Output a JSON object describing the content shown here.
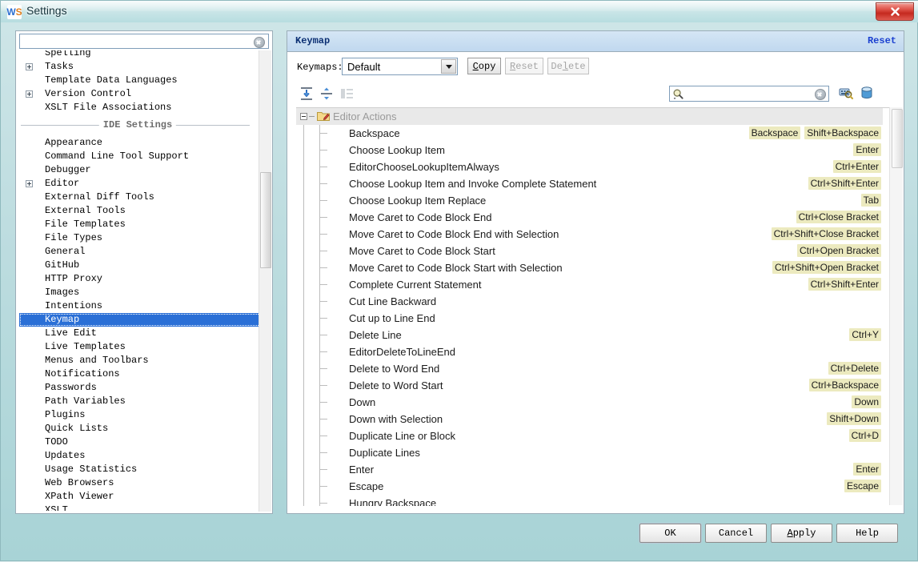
{
  "window": {
    "title": "Settings",
    "app_icon": "webstorm-icon",
    "close_label": "close-icon"
  },
  "sidebar": {
    "search": {
      "value": "",
      "placeholder": ""
    },
    "clear_icon": "clear-icon",
    "sections": [
      {
        "type": "items",
        "items": [
          {
            "label": "Spelling",
            "expandable": false,
            "selected": false
          },
          {
            "label": "Tasks",
            "expandable": true,
            "selected": false
          },
          {
            "label": "Template Data Languages",
            "expandable": false,
            "selected": false
          },
          {
            "label": "Version Control",
            "expandable": true,
            "selected": false
          },
          {
            "label": "XSLT File Associations",
            "expandable": false,
            "selected": false
          }
        ]
      },
      {
        "type": "separator",
        "label": "IDE Settings"
      },
      {
        "type": "items",
        "items": [
          {
            "label": "Appearance",
            "expandable": false,
            "selected": false
          },
          {
            "label": "Command Line Tool Support",
            "expandable": false,
            "selected": false
          },
          {
            "label": "Debugger",
            "expandable": false,
            "selected": false
          },
          {
            "label": "Editor",
            "expandable": true,
            "selected": false
          },
          {
            "label": "External Diff Tools",
            "expandable": false,
            "selected": false
          },
          {
            "label": "External Tools",
            "expandable": false,
            "selected": false
          },
          {
            "label": "File Templates",
            "expandable": false,
            "selected": false
          },
          {
            "label": "File Types",
            "expandable": false,
            "selected": false
          },
          {
            "label": "General",
            "expandable": false,
            "selected": false
          },
          {
            "label": "GitHub",
            "expandable": false,
            "selected": false
          },
          {
            "label": "HTTP Proxy",
            "expandable": false,
            "selected": false
          },
          {
            "label": "Images",
            "expandable": false,
            "selected": false
          },
          {
            "label": "Intentions",
            "expandable": false,
            "selected": false
          },
          {
            "label": "Keymap",
            "expandable": false,
            "selected": true
          },
          {
            "label": "Live Edit",
            "expandable": false,
            "selected": false
          },
          {
            "label": "Live Templates",
            "expandable": false,
            "selected": false
          },
          {
            "label": "Menus and Toolbars",
            "expandable": false,
            "selected": false
          },
          {
            "label": "Notifications",
            "expandable": false,
            "selected": false
          },
          {
            "label": "Passwords",
            "expandable": false,
            "selected": false
          },
          {
            "label": "Path Variables",
            "expandable": false,
            "selected": false
          },
          {
            "label": "Plugins",
            "expandable": false,
            "selected": false
          },
          {
            "label": "Quick Lists",
            "expandable": false,
            "selected": false
          },
          {
            "label": "TODO",
            "expandable": false,
            "selected": false
          },
          {
            "label": "Updates",
            "expandable": false,
            "selected": false
          },
          {
            "label": "Usage Statistics",
            "expandable": false,
            "selected": false
          },
          {
            "label": "Web Browsers",
            "expandable": false,
            "selected": false
          },
          {
            "label": "XPath Viewer",
            "expandable": false,
            "selected": false
          },
          {
            "label": "XSLT",
            "expandable": false,
            "selected": false
          }
        ]
      }
    ]
  },
  "panel": {
    "title": "Keymap",
    "reset_link": "Reset",
    "keymaps_label": "Keymaps:",
    "keymap_selected": "Default",
    "keymap_options": [
      "Default"
    ],
    "buttons": [
      {
        "label": "Copy",
        "mnemonic": "C",
        "disabled": false,
        "name": "copy-keymap-button"
      },
      {
        "label": "Reset",
        "mnemonic": "R",
        "disabled": true,
        "name": "reset-keymap-button"
      },
      {
        "label": "Delete",
        "mnemonic": "l",
        "disabled": true,
        "name": "delete-keymap-button"
      }
    ],
    "toolbar": {
      "expand_all": "expand-all-icon",
      "collapse_all": "collapse-all-icon",
      "filter": "show-structure-icon",
      "search_value": "",
      "search_placeholder": "",
      "search_icon": "search-icon",
      "search_clear_icon": "clear-icon",
      "find_by_shortcut_icon": "find-by-shortcut-icon",
      "bin_icon": "keyboard-shortcut-bin-icon"
    }
  },
  "tree": {
    "root": {
      "label": "Editor Actions",
      "icon": "folder-edit-icon",
      "expanded": true
    },
    "rows": [
      {
        "name": "Backspace",
        "shortcuts": [
          "Backspace",
          "Shift+Backspace"
        ]
      },
      {
        "name": "Choose Lookup Item",
        "shortcuts": [
          "Enter"
        ]
      },
      {
        "name": "EditorChooseLookupItemAlways",
        "shortcuts": [
          "Ctrl+Enter"
        ]
      },
      {
        "name": "Choose Lookup Item and Invoke Complete Statement",
        "shortcuts": [
          "Ctrl+Shift+Enter"
        ]
      },
      {
        "name": "Choose Lookup Item Replace",
        "shortcuts": [
          "Tab"
        ]
      },
      {
        "name": "Move Caret to Code Block End",
        "shortcuts": [
          "Ctrl+Close Bracket"
        ]
      },
      {
        "name": "Move Caret to Code Block End with Selection",
        "shortcuts": [
          "Ctrl+Shift+Close Bracket"
        ]
      },
      {
        "name": "Move Caret to Code Block Start",
        "shortcuts": [
          "Ctrl+Open Bracket"
        ]
      },
      {
        "name": "Move Caret to Code Block Start with Selection",
        "shortcuts": [
          "Ctrl+Shift+Open Bracket"
        ]
      },
      {
        "name": "Complete Current Statement",
        "shortcuts": [
          "Ctrl+Shift+Enter"
        ]
      },
      {
        "name": "Cut Line Backward",
        "shortcuts": []
      },
      {
        "name": "Cut up to Line End",
        "shortcuts": []
      },
      {
        "name": "Delete Line",
        "shortcuts": [
          "Ctrl+Y"
        ]
      },
      {
        "name": "EditorDeleteToLineEnd",
        "shortcuts": []
      },
      {
        "name": "Delete to Word End",
        "shortcuts": [
          "Ctrl+Delete"
        ]
      },
      {
        "name": "Delete to Word Start",
        "shortcuts": [
          "Ctrl+Backspace"
        ]
      },
      {
        "name": "Down",
        "shortcuts": [
          "Down"
        ]
      },
      {
        "name": "Down with Selection",
        "shortcuts": [
          "Shift+Down"
        ]
      },
      {
        "name": "Duplicate Line or Block",
        "shortcuts": [
          "Ctrl+D"
        ]
      },
      {
        "name": "Duplicate Lines",
        "shortcuts": []
      },
      {
        "name": "Enter",
        "shortcuts": [
          "Enter"
        ]
      },
      {
        "name": "Escape",
        "shortcuts": [
          "Escape"
        ]
      },
      {
        "name": "Hungry Backspace",
        "shortcuts": []
      }
    ]
  },
  "footer": {
    "buttons": [
      {
        "label": "OK",
        "mnemonic": "",
        "name": "ok-button"
      },
      {
        "label": "Cancel",
        "mnemonic": "",
        "name": "cancel-button"
      },
      {
        "label": "Apply",
        "mnemonic": "A",
        "name": "apply-button"
      },
      {
        "label": "Help",
        "mnemonic": "",
        "name": "help-button"
      }
    ]
  },
  "colors": {
    "accent": "#2a6fd6",
    "shortcut_bg": "#eceabf",
    "header_blue": "#0b2f73",
    "link_blue": "#1a3fd0",
    "window_chrome": "#bedde0"
  }
}
